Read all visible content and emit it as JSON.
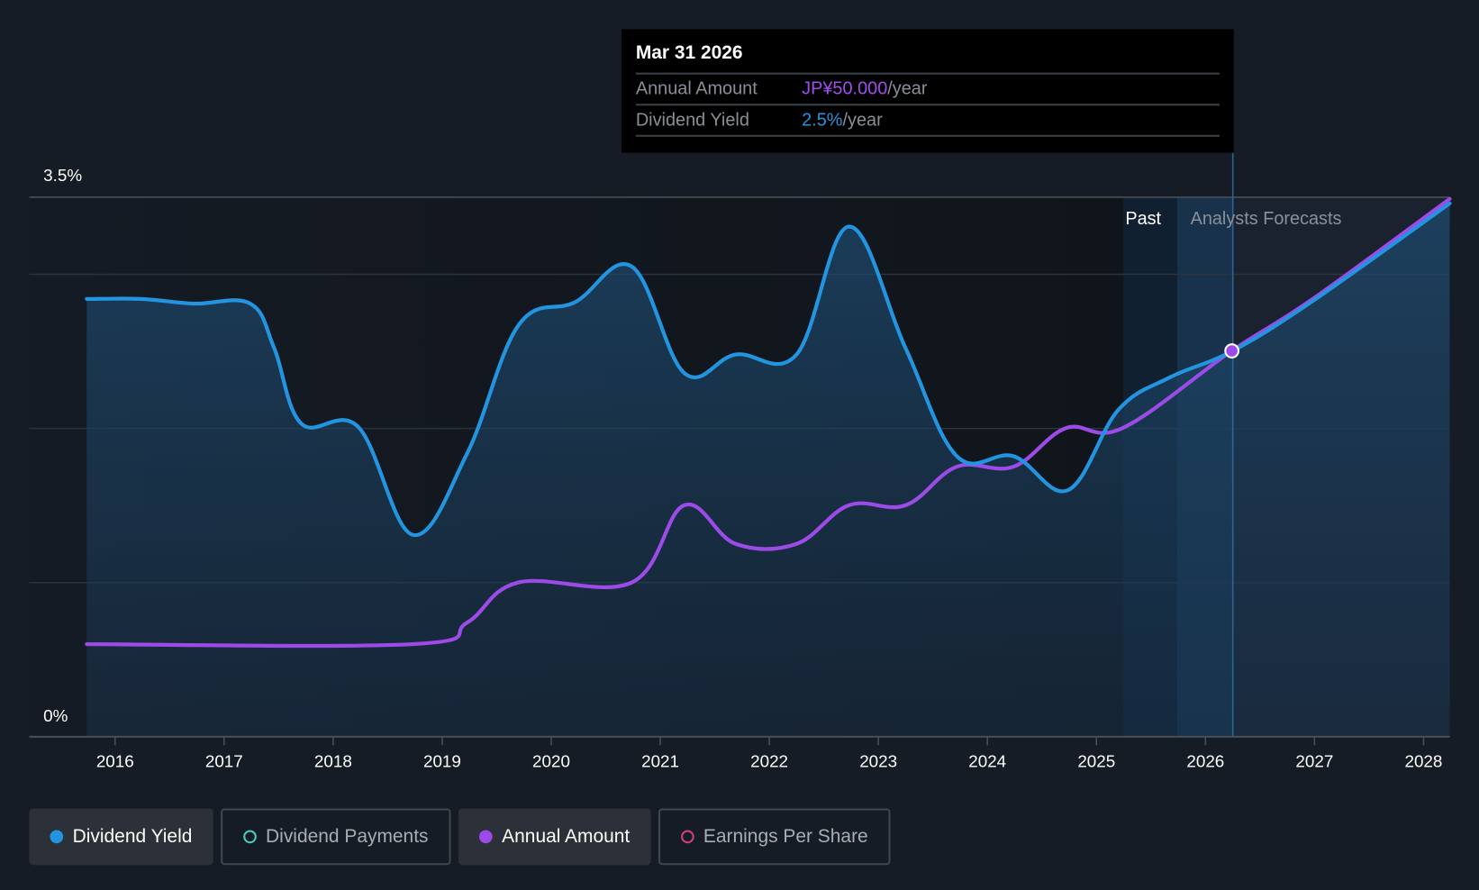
{
  "chart_data": {
    "type": "line",
    "title": "",
    "ylabel": "Dividend Yield",
    "y_ticks_labeled": [
      "0%",
      "3.5%"
    ],
    "ylim": [
      0,
      3.5
    ],
    "gridlines": [
      1,
      2,
      3,
      3.5
    ],
    "x_ticks": [
      "2016",
      "2017",
      "2018",
      "2019",
      "2020",
      "2021",
      "2022",
      "2023",
      "2024",
      "2025",
      "2026",
      "2027",
      "2028"
    ],
    "xlim": [
      2015.26,
      2028.24
    ],
    "regions": {
      "past_label": "Past",
      "forecast_label": "Analysts Forecasts",
      "past_band_start": 2025.25,
      "forecast_start": 2026.25
    },
    "series": [
      {
        "name": "Dividend Yield",
        "unit": "%",
        "color": "#2394df",
        "x": [
          2015.74,
          2016.24,
          2016.72,
          2017.24,
          2017.46,
          2017.71,
          2018.23,
          2018.73,
          2019.23,
          2019.7,
          2020.22,
          2020.74,
          2021.22,
          2021.69,
          2022.25,
          2022.73,
          2023.25,
          2023.72,
          2024.24,
          2024.74,
          2025.2,
          2025.67,
          2026.24,
          2026.97,
          2028.24
        ],
        "y": [
          2.84,
          2.84,
          2.81,
          2.81,
          2.52,
          2.03,
          2.01,
          1.31,
          1.84,
          2.67,
          2.82,
          3.05,
          2.36,
          2.48,
          2.48,
          3.31,
          2.52,
          1.82,
          1.82,
          1.6,
          2.12,
          2.33,
          2.5,
          2.82,
          3.46
        ]
      },
      {
        "name": "Annual Amount",
        "unit": "JPY",
        "color": "#9d4be8",
        "x": [
          2015.74,
          2018.73,
          2019.23,
          2019.7,
          2020.74,
          2021.22,
          2021.69,
          2022.25,
          2022.73,
          2023.25,
          2023.72,
          2024.24,
          2024.72,
          2025.24,
          2026.24,
          2026.97,
          2028.24
        ],
        "y": [
          12,
          12,
          14.8,
          20,
          20,
          30,
          25,
          25,
          30,
          30,
          35,
          35,
          40,
          40,
          50,
          56.6,
          69.7
        ]
      }
    ]
  },
  "tooltip": {
    "date": "Mar 31 2026",
    "annual_label": "Annual Amount",
    "annual_value": "JP¥50.000",
    "annual_unit": "/year",
    "yield_label": "Dividend Yield",
    "yield_value": "2.5%",
    "yield_unit": "/year"
  },
  "legend": [
    {
      "label": "Dividend Yield",
      "color": "#2394df",
      "active": true
    },
    {
      "label": "Dividend Payments",
      "color": "#4fc7b8",
      "active": false
    },
    {
      "label": "Annual Amount",
      "color": "#9d4be8",
      "active": true
    },
    {
      "label": "Earnings Per Share",
      "color": "#c8407c",
      "active": false
    }
  ]
}
